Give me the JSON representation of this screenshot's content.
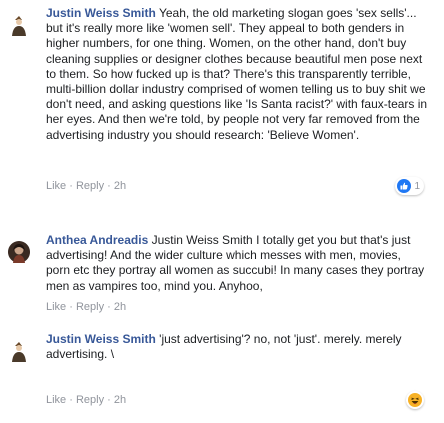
{
  "comments": [
    {
      "author": "Justin Weiss Smith",
      "text": "Yeah, the old marketing slogan goes 'sex sells'... but it's really more like 'women sell'. They appeal to both genders in higher numbers, for one thing. Women, on the other hand, don't buy cleaning supplies or designer clothes because beautiful men pose next to them. So how fucked up is that? There's this transparently terrible, multi-billion dollar industry comprised of women telling us to buy shit we don't need, and asking questions like 'Is Santa racist?' with faux-tears in her eyes. And then we're told, by people not very far removed from the advertising industry you should research: 'Believe Women'.",
      "like": "Like",
      "reply": "Reply",
      "time": "2h",
      "reaction_icon": "like-reaction-icon",
      "reaction_count": "1"
    },
    {
      "author": "Anthea Andreadis",
      "text": "Justin Weiss Smith I totally get you but that's just advertising! And the wider culture which messes with men, movies, porn etc they portray all women as succubi! In many cases they portray men as vampires too, mind you. Anyhoo,",
      "like": "Like",
      "reply": "Reply",
      "time": "2h"
    },
    {
      "author": "Justin Weiss Smith",
      "text": "'just advertising'? no, not 'just'. merely. merely advertising. \\",
      "like": "Like",
      "reply": "Reply",
      "time": "2h",
      "reaction_icon": "haha-reaction-icon"
    }
  ],
  "colors": {
    "author": "#385898",
    "text": "#1c1e21",
    "meta": "#90949c",
    "like_blue": "#2078f4",
    "haha_yellow": "#f7b125"
  },
  "separator": "·"
}
